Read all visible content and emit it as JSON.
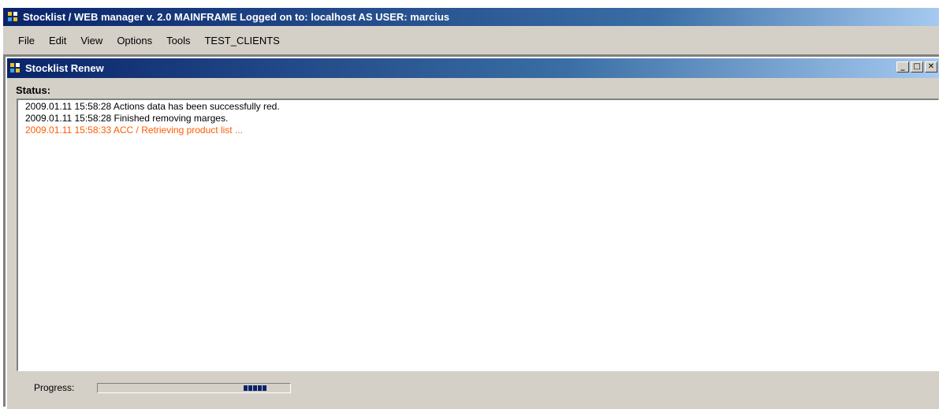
{
  "app": {
    "title": "Stocklist / WEB manager  v. 2.0 MAINFRAME Logged on to: localhost AS USER: marcius"
  },
  "menu": {
    "items": [
      "File",
      "Edit",
      "View",
      "Options",
      "Tools",
      "TEST_CLIENTS"
    ]
  },
  "child_window": {
    "title": "Stocklist Renew",
    "buttons": {
      "minimize": "_",
      "maximize": "□",
      "close": "✕"
    }
  },
  "status": {
    "label": "Status:",
    "lines": [
      {
        "text": "2009.01.11 15:58:28 Actions data has been successfully red.",
        "color": "#000000"
      },
      {
        "text": "2009.01.11 15:58:28 Finished removing marges.",
        "color": "#000000"
      },
      {
        "text": "2009.01.11 15:58:33 ACC / Retrieving product list ...",
        "color": "#ff5a00"
      }
    ]
  },
  "progress": {
    "label": "Progress:",
    "marquee_position": 0.82,
    "block_count": 5
  },
  "colors": {
    "titlebar_start": "#0a246a",
    "titlebar_end": "#a6caf0",
    "window_bg": "#d4d0c8",
    "progress_block": "#0a246a",
    "log_highlight": "#ff5a00"
  }
}
